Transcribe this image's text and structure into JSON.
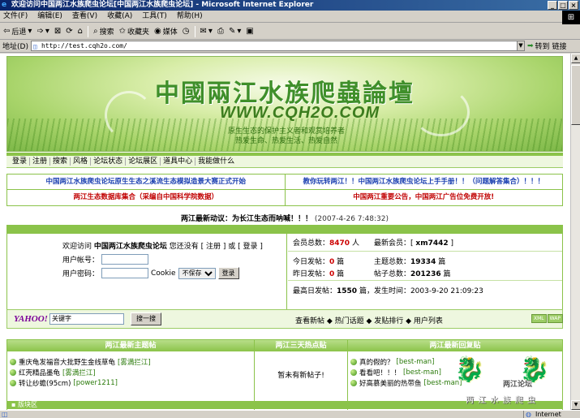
{
  "window": {
    "title": "欢迎访问中国两江水族爬虫论坛[中国两江水族爬虫论坛] - Microsoft Internet Explorer",
    "minimize": "_",
    "maximize": "□",
    "close": "×"
  },
  "menu": [
    "文件(F)",
    "编辑(E)",
    "查看(V)",
    "收藏(A)",
    "工具(T)",
    "帮助(H)"
  ],
  "toolbar": {
    "back": "后退",
    "search": "搜索",
    "favorites": "收藏夹",
    "media": "媒体"
  },
  "address": {
    "label": "地址(D)",
    "url": "http://test.cqh2o.com/",
    "go": "转到",
    "links": "链接"
  },
  "banner": {
    "logo": "中國兩江水族爬蟲論壇",
    "domain": "WWW.CQH2O.COM",
    "slogan1": "原生生态的保护主义者和观赏培养者",
    "slogan2": "热爱生命、热爱生活、热爱自然"
  },
  "nav": [
    "登录",
    "注册",
    "搜索",
    "风格",
    "论坛状态",
    "论坛展区",
    "道具中心",
    "我能做什么"
  ],
  "notices": [
    [
      "中国两江水族爬虫论坛原生生态之溪流生态模拟造景大赛正式开始",
      "教你玩转两江！！中国两江水族爬虫论坛上手手册！！（问题解答集合）！！！"
    ],
    [
      "两江生态数据库集合（采编自中国科学院数据）",
      "中国两江重要公告，中国两江广告位免费开放!"
    ]
  ],
  "latest": {
    "label": "两江最新动议：为长江生态而呐喊！！！",
    "time": "(2007-4-26 7:48:32)"
  },
  "login": {
    "welcome_pre": "欢迎访问",
    "forum": "中国两江水族爬虫论坛",
    "welcome_post": "您还没有 [ 注册 ] 或 [ 登录 ]",
    "user_label": "用户帐号：",
    "pass_label": "用户密码：",
    "cookie": "Cookie",
    "cookie_option": "不保存",
    "submit": "登录"
  },
  "stats": {
    "members_label": "会员总数：",
    "members": "8470",
    "members_unit": "人",
    "newest_label": "最新会员：[",
    "newest": "xm7442",
    "newest_end": "]",
    "today_label": "今日发帖：",
    "today": "0",
    "today_unit": "篇",
    "topics_label": "主题总数：",
    "topics": "19334",
    "topics_unit": "篇",
    "yesterday_label": "昨日发帖：",
    "yesterday": "0",
    "yesterday_unit": "篇",
    "posts_label": "帖子总数：",
    "posts": "201236",
    "posts_unit": "篇",
    "peak_label": "最高日发帖：",
    "peak": "1550",
    "peak_text": "篇，发生时间：2003-9-20 21:09:23"
  },
  "search": {
    "brand": "YAHOO!",
    "placeholder": "关键字",
    "button": "搜一搜",
    "links": "查看新帖 ◆ 热门话题 ◆ 发贴排行 ◆ 用户列表",
    "badge1": "XML",
    "badge2": "WAP"
  },
  "columns": {
    "new_topics": {
      "title": "两江最新主题帖",
      "items": [
        {
          "text": "重庆龟发福音大批野生金线草龟",
          "user": "[雾満拦江]"
        },
        {
          "text": "红壳精品墨龟",
          "user": "[雾満拦江]"
        },
        {
          "text": "转让纱蟾(95cm)",
          "user": "[power1211]"
        }
      ]
    },
    "hot": {
      "title": "两江三天热点贴",
      "empty": "暂未有新帖子!"
    },
    "replies": {
      "title": "两江最新回复贴",
      "items": [
        {
          "text": "真的假的？",
          "user": "[best-man]"
        },
        {
          "text": "看看吧！！！",
          "user": "[best-man]"
        },
        {
          "text": "好高慕美丽的热带鱼",
          "user": "[best-man]"
        }
      ]
    }
  },
  "bottom_head": "▪ 版块区",
  "watermark": {
    "text": "两 江 水 族 爬 虫",
    "name": "两江论坛"
  },
  "statusbar": {
    "zone": "Internet"
  }
}
